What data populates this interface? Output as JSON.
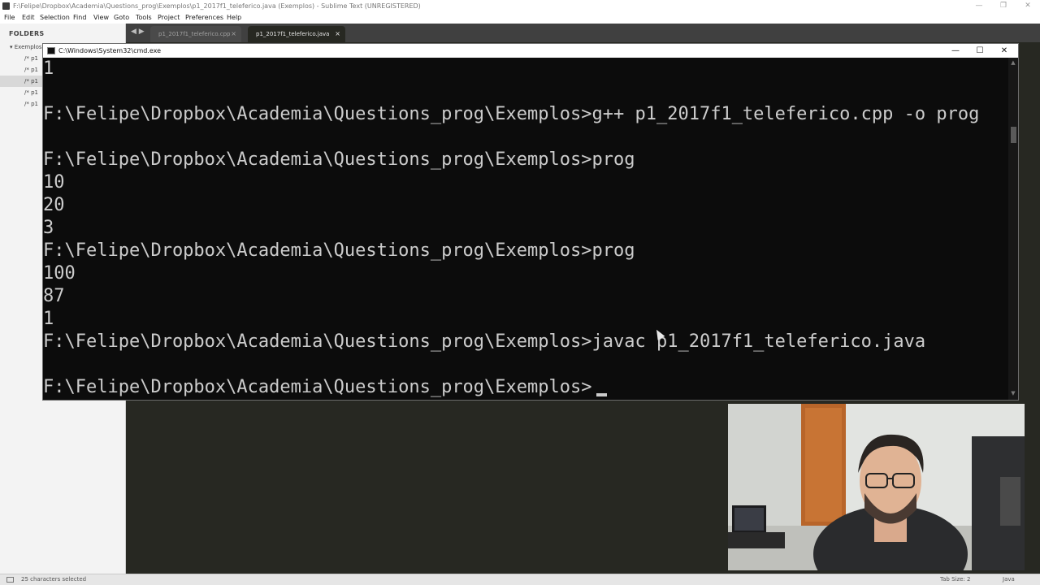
{
  "sublime": {
    "window_title": "F:\\Felipe\\Dropbox\\Academia\\Questions_prog\\Exemplos\\p1_2017f1_teleferico.java (Exemplos) - Sublime Text (UNREGISTERED)",
    "menu": [
      "File",
      "Edit",
      "Selection",
      "Find",
      "View",
      "Goto",
      "Tools",
      "Project",
      "Preferences",
      "Help"
    ],
    "sidebar": {
      "title": "FOLDERS",
      "items": [
        {
          "label": "Exemplos"
        },
        {
          "label": "/*  p1"
        },
        {
          "label": "/*  p1"
        },
        {
          "label": "/*  p1"
        },
        {
          "label": "/*  p1"
        },
        {
          "label": "/*  p1"
        }
      ]
    },
    "tabs": [
      {
        "label": "p1_2017f1_teleferico.cpp",
        "active": false
      },
      {
        "label": "p1_2017f1_teleferico.java",
        "active": true
      }
    ],
    "nav_arrows": "◀ ▶",
    "close_glyph": "×",
    "status": {
      "left": "25 characters selected",
      "tab_size": "Tab Size: 2",
      "syntax": "Java"
    }
  },
  "cmd": {
    "title": "C:\\Windows\\System32\\cmd.exe",
    "lines": [
      "1",
      "",
      "F:\\Felipe\\Dropbox\\Academia\\Questions_prog\\Exemplos>g++ p1_2017f1_teleferico.cpp -o prog",
      "",
      "F:\\Felipe\\Dropbox\\Academia\\Questions_prog\\Exemplos>prog",
      "10",
      "20",
      "3",
      "F:\\Felipe\\Dropbox\\Academia\\Questions_prog\\Exemplos>prog",
      "100",
      "87",
      "1",
      "F:\\Felipe\\Dropbox\\Academia\\Questions_prog\\Exemplos>javac p1_2017f1_teleferico.java",
      "",
      "F:\\Felipe\\Dropbox\\Academia\\Questions_prog\\Exemplos>"
    ]
  },
  "colors": {
    "console_bg": "#0c0c0c",
    "console_text": "#cccccc",
    "editor_bg": "#272822",
    "tabbar_bg": "#404040"
  },
  "icons": {
    "minimize": "minimize-icon",
    "maximize": "maximize-icon",
    "close": "close-icon"
  }
}
